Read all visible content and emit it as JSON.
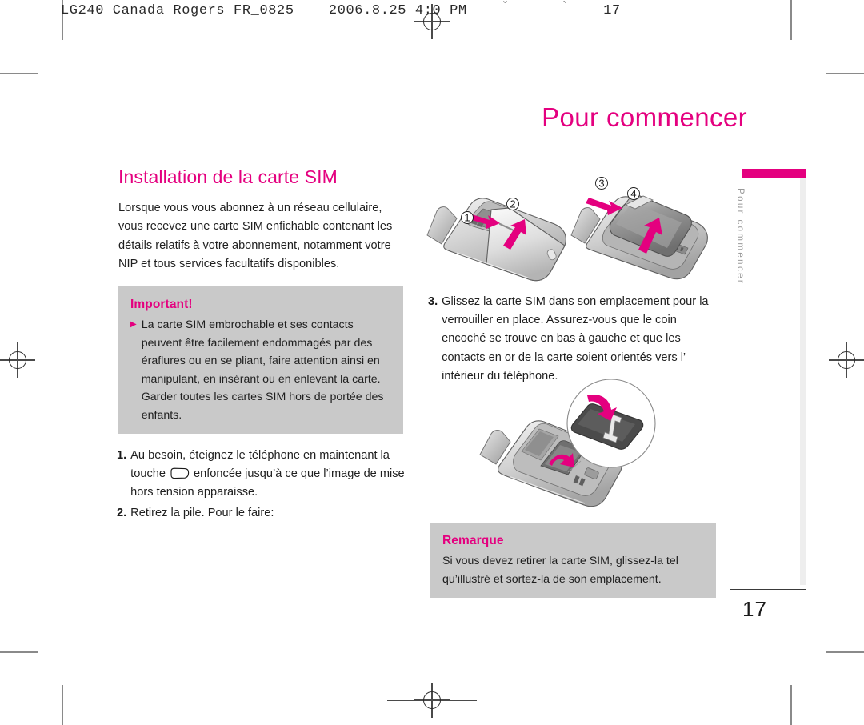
{
  "prepress": {
    "slug_left": "LG240 Canada Rogers FR_0825",
    "slug_mid": "2006.8.25 4:0 PM",
    "slug_tick1": "˘",
    "slug_tick2": "`",
    "slug_page": "17"
  },
  "chapter": {
    "title": "Pour commencer",
    "tab_label": "Pour commencer",
    "accent_color": "#e4007f"
  },
  "section": {
    "title": "Installation de la carte SIM",
    "intro": "Lorsque vous vous abonnez à un réseau cellulaire, vous recevez une carte SIM enfichable contenant les détails relatifs à votre abonnement, notamment votre NIP et tous services facultatifs disponibles."
  },
  "important_box": {
    "heading": "Important!",
    "bullet_marker": "▶",
    "bullet": "La carte SIM embrochable et ses contacts peuvent être facilement endommagés par des éraflures ou en se pliant, faire attention ainsi en manipulant, en insérant ou en enlevant la carte. Garder toutes les cartes SIM hors de portée des enfants."
  },
  "steps": {
    "step1": {
      "number": "1.",
      "text_before_key": "Au besoin, éteignez le téléphone en maintenant la touche",
      "text_after_key": "enfoncée jusqu’à ce que l’image de mise hors tension apparaisse."
    },
    "step2": {
      "number": "2.",
      "text": "Retirez la pile. Pour le faire:"
    },
    "step3": {
      "number": "3.",
      "text": "Glissez la carte SIM dans son emplacement pour la verrouiller en place. Assurez-vous que le coin encoché se trouve en bas à gauche et que les contacts en or de la carte soient orientés vers l’ intérieur du téléphone."
    }
  },
  "note_box": {
    "heading": "Remarque",
    "text": "Si vous devez retirer la carte SIM, glissez-la tel qu’illustré et sortez-la de son emplacement."
  },
  "illustrations": {
    "battery_cover": {
      "name": "phone-battery-cover-removal",
      "callouts": [
        "①",
        "②"
      ]
    },
    "battery_out": {
      "name": "phone-battery-removal",
      "callouts": [
        "③",
        "④"
      ]
    },
    "sim_insert": {
      "name": "phone-sim-insertion-with-detail-circle",
      "callouts": []
    }
  },
  "folio": {
    "page_number": "17"
  }
}
